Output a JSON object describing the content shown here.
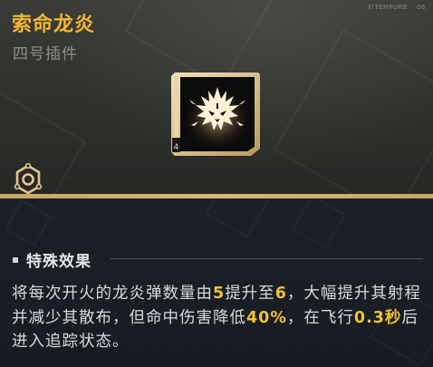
{
  "item": {
    "name": "索命龙炎",
    "type": "四号插件",
    "corner_text": "XITEMPURE",
    "corner_num": "06",
    "icon": "dragon-emblem-icon",
    "tier_icon": "hexagon-tier-icon",
    "icon_slot_label": "4"
  },
  "effect": {
    "title": "特殊效果",
    "desc_line1_a": "将每次开火的龙炎弹数量由",
    "desc_v1": "5",
    "desc_line1_b": "提升至",
    "desc_v2": "6",
    "desc_line1_c": "，大幅提升其射程并减少其散布，但命中伤害降低",
    "desc_v3": "40%",
    "desc_line1_d": "，在飞行",
    "desc_v4": "0.3秒",
    "desc_line1_e": "后进入追踪状态。"
  },
  "colors": {
    "accent_gold": "#f0b62e",
    "highlight": "#f2c230",
    "divider": "#d9b77a"
  }
}
